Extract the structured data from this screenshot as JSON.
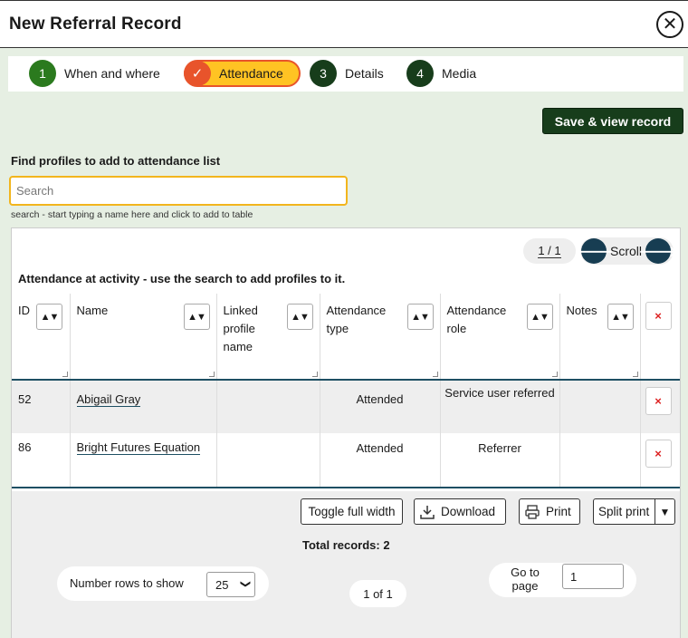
{
  "header": {
    "title": "New Referral Record",
    "close_icon": "close-icon"
  },
  "steps": [
    {
      "num": "1",
      "label": "When and where",
      "color": "#2b7a1e"
    },
    {
      "num": "✓",
      "label": "Attendance",
      "color": "#e8542b",
      "active": true
    },
    {
      "num": "3",
      "label": "Details",
      "color": "#173d1b"
    },
    {
      "num": "4",
      "label": "Media",
      "color": "#173d1b"
    }
  ],
  "save_label": "Save & view record",
  "search": {
    "label": "Find profiles to add to attendance list",
    "placeholder": "Search",
    "hint": "search - start typing a name here and click to add to table"
  },
  "pager": {
    "chip": "1 / 1",
    "scroll_label": "Scroll"
  },
  "table": {
    "caption": "Attendance at activity - use the search to add profiles to it.",
    "columns": [
      "ID",
      "Name",
      "Linked profile name",
      "Attendance type",
      "Attendance role",
      "Notes"
    ],
    "sort_glyph": "▲▼",
    "delete_glyph": "×",
    "rows": [
      {
        "id": "52",
        "name": "Abigail Gray",
        "linked": "",
        "type": "Attended",
        "role": "Service user referred",
        "notes": ""
      },
      {
        "id": "86",
        "name": "Bright Futures Equation",
        "linked": "",
        "type": "Attended",
        "role": "Referrer",
        "notes": ""
      }
    ]
  },
  "tools": {
    "toggle": "Toggle full width",
    "download": "Download",
    "print": "Print",
    "split": "Split print"
  },
  "total": "Total records: 2",
  "rows_to_show": {
    "label": "Number rows to show",
    "value": "25"
  },
  "page_info": "1 of 1",
  "goto": {
    "label": "Go to page",
    "value": "1"
  },
  "colors": {
    "accent_dark": "#173d1b",
    "active_step": "#e8542b",
    "active_fill": "#ffc323",
    "focus": "#f2b51d"
  }
}
